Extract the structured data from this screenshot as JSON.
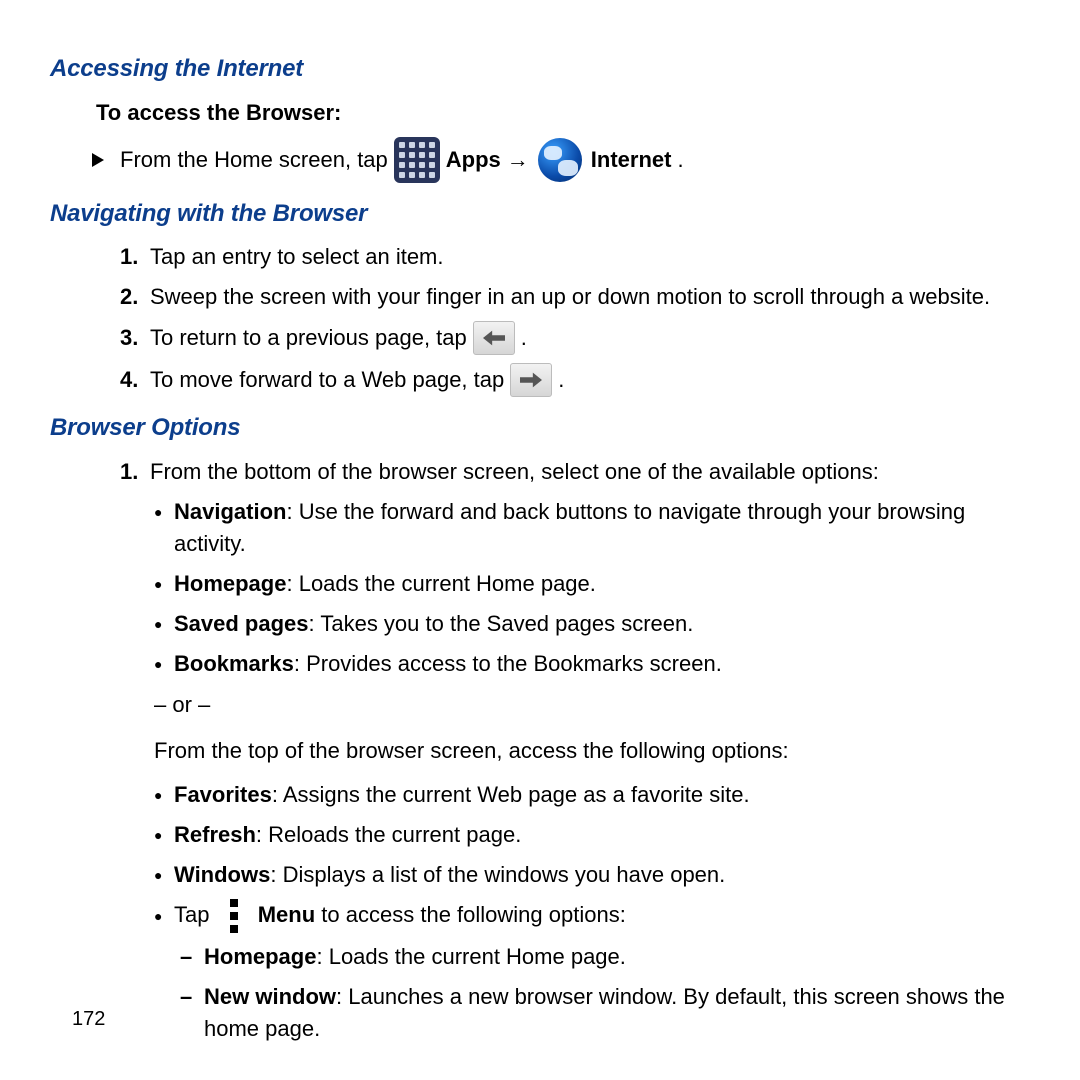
{
  "sections": {
    "s1_title": "Accessing the Internet",
    "s1_subhead": "To access the Browser:",
    "s1_line_pre": "From the Home screen, tap",
    "s1_apps": "Apps",
    "s1_arrow": "→",
    "s1_internet": "Internet",
    "s1_period": ".",
    "s2_title": "Navigating with the Browser",
    "s2_items": {
      "n1": "Tap an entry to select an item.",
      "n2": "Sweep the screen with your finger in an up or down motion to scroll through a website.",
      "n3_pre": "To return to a previous page, tap",
      "n3_post": ".",
      "n4_pre": "To move forward to a Web page, tap",
      "n4_post": "."
    },
    "s3_title": "Browser Options",
    "s3_item1": "From the bottom of the browser screen, select one of the available options:",
    "s3_bullets_a": {
      "nav_b": "Navigation",
      "nav_t": ": Use the forward and back buttons to navigate through your browsing activity.",
      "home_b": "Homepage",
      "home_t": ": Loads the current Home page.",
      "saved_b": "Saved pages",
      "saved_t": ": Takes you to the Saved pages screen.",
      "book_b": "Bookmarks",
      "book_t": ": Provides access to the Bookmarks screen."
    },
    "s3_or": "– or –",
    "s3_line2": "From the top of the browser screen, access the following options:",
    "s3_bullets_b": {
      "fav_b": "Favorites",
      "fav_t": ": Assigns the current Web page as a favorite site.",
      "ref_b": "Refresh",
      "ref_t": ": Reloads the current page.",
      "win_b": "Windows",
      "win_t": ": Displays a list of the windows you have open.",
      "tap_pre": "Tap",
      "menu_b": "Menu",
      "menu_t": " to access the following options:"
    },
    "s3_sub": {
      "hp_b": "Homepage",
      "hp_t": ": Loads the current Home page.",
      "nw_b": "New window",
      "nw_t": ": Launches a new browser window. By default, this screen shows the home page."
    }
  },
  "page_number": "172"
}
